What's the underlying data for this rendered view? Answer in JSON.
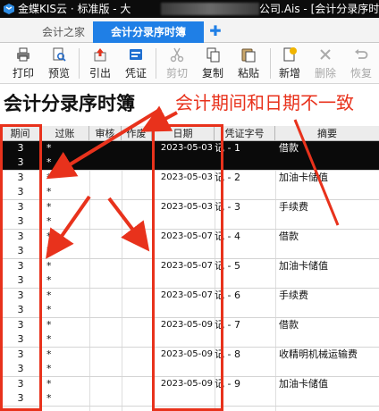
{
  "window": {
    "title_left": "金蝶KIS云 · 标准版 - 大",
    "title_right": "公司.Ais - [会计分录序时簿"
  },
  "tabs": [
    {
      "label": "会计之家"
    },
    {
      "label": "会计分录序时簿"
    }
  ],
  "tab_add": "✚",
  "toolbar": {
    "print": "打印",
    "preview": "预览",
    "import": "引出",
    "voucher": "凭证",
    "cut": "剪切",
    "copy": "复制",
    "paste": "粘贴",
    "new": "新增",
    "delete": "删除",
    "restore": "恢复"
  },
  "page_title": "会计分录序时簿",
  "annotation": "会计期间和日期不一致",
  "columns": {
    "period": "期间",
    "posted": "过账",
    "audit": "审核",
    "void": "作废",
    "date": "日期",
    "voucher_no": "凭证字号",
    "summary": "摘要"
  },
  "rows": [
    {
      "period": "3",
      "period2": "3",
      "mark": "*",
      "mark2": "*",
      "date": "2023-05-03",
      "vno": "记 - 1",
      "summary": "借款"
    },
    {
      "period": "3",
      "period2": "3",
      "mark": "*",
      "mark2": "*",
      "date": "2023-05-03",
      "vno": "记 - 2",
      "summary": "加油卡储值"
    },
    {
      "period": "3",
      "period2": "3",
      "mark": "*",
      "mark2": "*",
      "date": "2023-05-03",
      "vno": "记 - 3",
      "summary": "手续费"
    },
    {
      "period": "3",
      "period2": "3",
      "mark": "*",
      "mark2": "*",
      "date": "2023-05-07",
      "vno": "记 - 4",
      "summary": "借款"
    },
    {
      "period": "3",
      "period2": "3",
      "mark": "*",
      "mark2": "*",
      "date": "2023-05-07",
      "vno": "记 - 5",
      "summary": "加油卡储值"
    },
    {
      "period": "3",
      "period2": "3",
      "mark": "*",
      "mark2": "*",
      "date": "2023-05-07",
      "vno": "记 - 6",
      "summary": "手续费"
    },
    {
      "period": "3",
      "period2": "3",
      "mark": "*",
      "mark2": "*",
      "date": "2023-05-09",
      "vno": "记 - 7",
      "summary": "借款"
    },
    {
      "period": "3",
      "period2": "3",
      "mark": "*",
      "mark2": "*",
      "date": "2023-05-09",
      "vno": "记 - 8",
      "summary": "收精明机械运输费"
    },
    {
      "period": "3",
      "period2": "3",
      "mark": "*",
      "mark2": "*",
      "date": "2023-05-09",
      "vno": "记 - 9",
      "summary": "加油卡储值"
    }
  ],
  "colors": {
    "accent": "#1f7fe6",
    "annotation_red": "#e8321c",
    "selected_row": "#0a0a0a"
  }
}
